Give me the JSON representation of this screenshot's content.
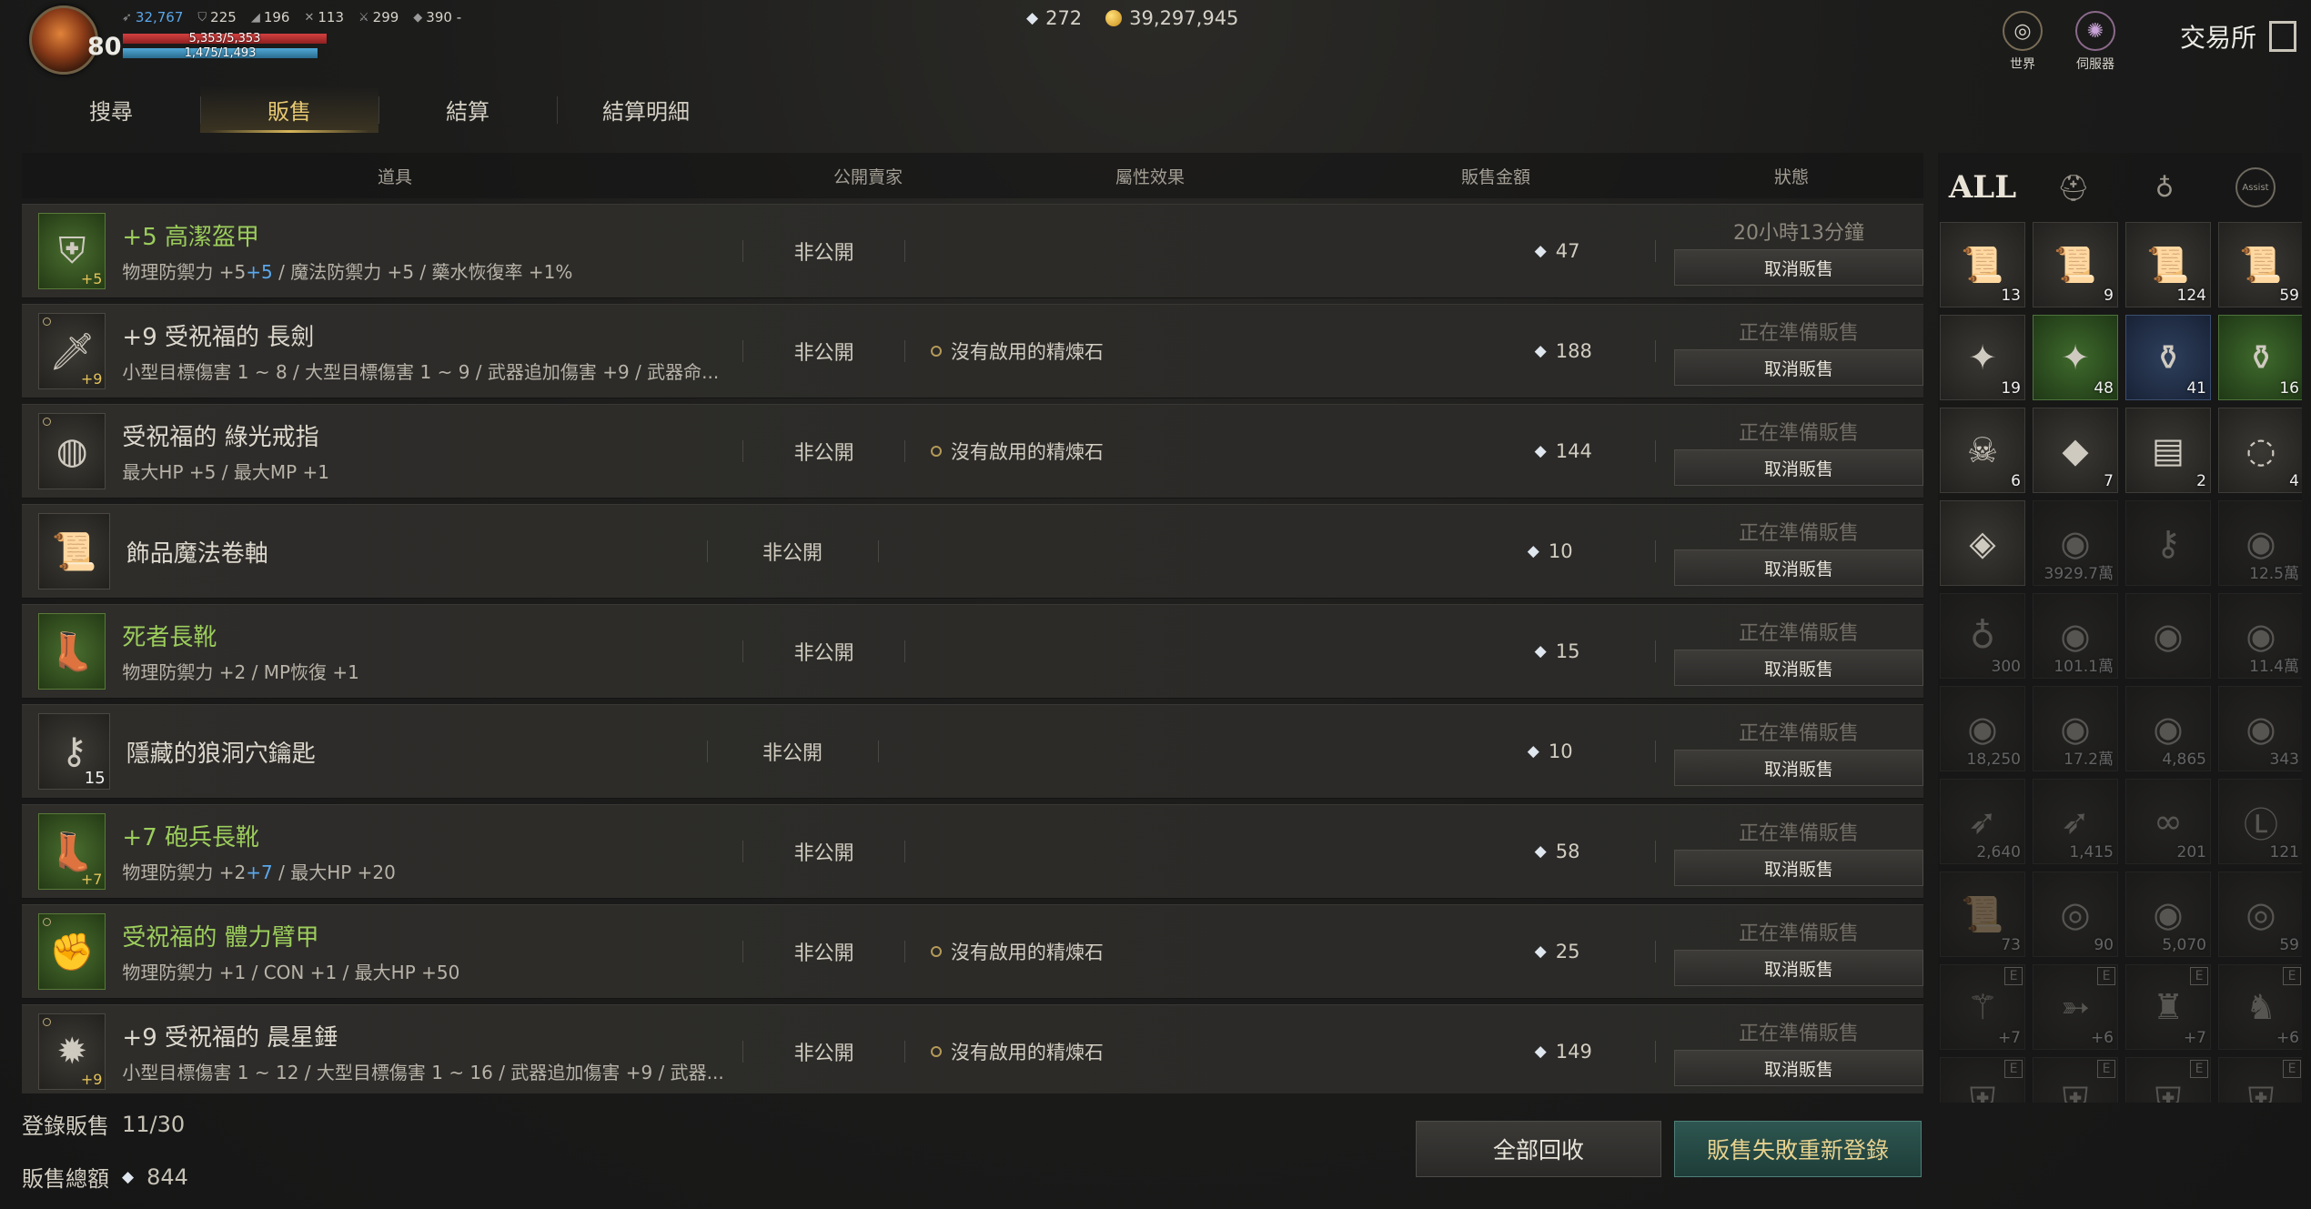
{
  "player": {
    "level": "80",
    "stats": [
      "32,767",
      "225",
      "196",
      "113",
      "299",
      "390 -"
    ],
    "hp": "5,353/5,353",
    "mp": "1,475/1,493"
  },
  "currency": {
    "gems": "272",
    "gold": "39,297,945"
  },
  "top_buttons": {
    "world": "世界",
    "server": "伺服器"
  },
  "exchange_title": "交易所",
  "tabs": [
    "搜尋",
    "販售",
    "結算",
    "結算明細"
  ],
  "table": {
    "headers": {
      "item": "道具",
      "buyer": "公開賣家",
      "effect": "屬性效果",
      "price": "販售金額",
      "status": "狀態"
    },
    "rows": [
      {
        "name": "+5 高潔盔甲",
        "name_color": "green",
        "attr_pre": "物理防禦力 +5",
        "attr_blue": "+5",
        "attr_post": " / 魔法防禦力 +5 / 藥水恢復率 +1%",
        "public": "非公開",
        "effect": "",
        "price": "47",
        "status": "20小時13分鐘",
        "cancel": "取消販售",
        "icon": "armor-icon",
        "plus": "+5",
        "qty": ""
      },
      {
        "name": "+9 受祝福的 長劍",
        "name_color": "white",
        "attr_pre": "小型目標傷害 1 ~ 8 / 大型目標傷害 1 ~ 9 / 武器追加傷害 +9 / 武器命...",
        "attr_blue": "",
        "attr_post": "",
        "public": "非公開",
        "effect": "沒有啟用的精煉石",
        "price": "188",
        "status": "正在準備販售",
        "cancel": "取消販售",
        "icon": "sword-icon",
        "plus": "+9",
        "qty": ""
      },
      {
        "name": "受祝福的 綠光戒指",
        "name_color": "white",
        "attr_pre": "最大HP +5 / 最大MP +1",
        "attr_blue": "",
        "attr_post": "",
        "public": "非公開",
        "effect": "沒有啟用的精煉石",
        "price": "144",
        "status": "正在準備販售",
        "cancel": "取消販售",
        "icon": "ring-icon",
        "plus": "",
        "qty": ""
      },
      {
        "name": "飾品魔法卷軸",
        "name_color": "white",
        "attr_pre": "",
        "attr_blue": "",
        "attr_post": "",
        "public": "非公開",
        "effect": "",
        "price": "10",
        "status": "正在準備販售",
        "cancel": "取消販售",
        "icon": "scroll-icon",
        "plus": "",
        "qty": ""
      },
      {
        "name": "死者長靴",
        "name_color": "green",
        "attr_pre": "物理防禦力 +2 / MP恢復 +1",
        "attr_blue": "",
        "attr_post": "",
        "public": "非公開",
        "effect": "",
        "price": "15",
        "status": "正在準備販售",
        "cancel": "取消販售",
        "icon": "boots-icon",
        "plus": "",
        "qty": ""
      },
      {
        "name": "隱藏的狼洞穴鑰匙",
        "name_color": "white",
        "attr_pre": "",
        "attr_blue": "",
        "attr_post": "",
        "public": "非公開",
        "effect": "",
        "price": "10",
        "status": "正在準備販售",
        "cancel": "取消販售",
        "icon": "key-icon",
        "plus": "",
        "qty": "15"
      },
      {
        "name": "+7 砲兵長靴",
        "name_color": "green",
        "attr_pre": "物理防禦力 +2",
        "attr_blue": "+7",
        "attr_post": " / 最大HP +20",
        "public": "非公開",
        "effect": "",
        "price": "58",
        "status": "正在準備販售",
        "cancel": "取消販售",
        "icon": "boots-icon",
        "plus": "+7",
        "qty": ""
      },
      {
        "name": "受祝福的 體力臂甲",
        "name_color": "green",
        "attr_pre": "物理防禦力 +1 / CON +1 / 最大HP +50",
        "attr_blue": "",
        "attr_post": "",
        "public": "非公開",
        "effect": "沒有啟用的精煉石",
        "price": "25",
        "status": "正在準備販售",
        "cancel": "取消販售",
        "icon": "gauntlet-icon",
        "plus": "",
        "qty": ""
      },
      {
        "name": "+9 受祝福的 晨星錘",
        "name_color": "white",
        "attr_pre": "小型目標傷害 1 ~ 12 / 大型目標傷害 1 ~ 16 / 武器追加傷害 +9 / 武器...",
        "attr_blue": "",
        "attr_post": "",
        "public": "非公開",
        "effect": "沒有啟用的精煉石",
        "price": "149",
        "status": "正在準備販售",
        "cancel": "取消販售",
        "icon": "mace-icon",
        "plus": "+9",
        "qty": ""
      }
    ]
  },
  "footer": {
    "listed_label": "登錄販售",
    "listed_value": "11/30",
    "total_label": "販售總額",
    "total_value": "844",
    "recall_button": "全部回收",
    "relist_button": "販售失敗重新登錄"
  },
  "inventory": {
    "categories": [
      "ALL",
      "helmet-icon",
      "bag-icon",
      "Assist"
    ],
    "slots": [
      {
        "icon": "scroll-icon",
        "count": "13",
        "style": "normal"
      },
      {
        "icon": "scroll-icon",
        "count": "9",
        "style": "normal"
      },
      {
        "icon": "scroll-icon",
        "count": "124",
        "style": "normal"
      },
      {
        "icon": "scroll-icon",
        "count": "59",
        "style": "normal"
      },
      {
        "icon": "crystal-icon",
        "count": "19",
        "style": "normal"
      },
      {
        "icon": "crystal-icon",
        "count": "48",
        "style": "green"
      },
      {
        "icon": "potion-icon",
        "count": "41",
        "style": "blue"
      },
      {
        "icon": "potion-icon",
        "count": "16",
        "style": "green"
      },
      {
        "icon": "bone-icon",
        "count": "6",
        "style": "normal"
      },
      {
        "icon": "gem-icon",
        "count": "7",
        "style": "normal"
      },
      {
        "icon": "log-icon",
        "count": "2",
        "style": "normal"
      },
      {
        "icon": "cloth-icon",
        "count": "4",
        "style": "normal"
      },
      {
        "icon": "diamond-icon",
        "count": "",
        "style": "normal"
      },
      {
        "icon": "coin-icon",
        "count": "3929.7萬",
        "style": "dim"
      },
      {
        "icon": "key-icon",
        "count": "",
        "style": "dim"
      },
      {
        "icon": "coin-icon",
        "count": "12.5萬",
        "style": "dim"
      },
      {
        "icon": "bag-icon",
        "count": "300",
        "style": "dim"
      },
      {
        "icon": "coin-icon",
        "count": "101.1萬",
        "style": "dim"
      },
      {
        "icon": "coin-icon",
        "count": "",
        "style": "dim"
      },
      {
        "icon": "coin-icon",
        "count": "11.4萬",
        "style": "dim"
      },
      {
        "icon": "coin-icon",
        "count": "18,250",
        "style": "dim"
      },
      {
        "icon": "coin-icon",
        "count": "17.2萬",
        "style": "dim"
      },
      {
        "icon": "coin-icon",
        "count": "4,865",
        "style": "dim"
      },
      {
        "icon": "coin-icon",
        "count": "343",
        "style": "dim"
      },
      {
        "icon": "feather-icon",
        "count": "2,640",
        "style": "dim"
      },
      {
        "icon": "feather-icon",
        "count": "1,415",
        "style": "dim"
      },
      {
        "icon": "infinity-icon",
        "count": "201",
        "style": "dim"
      },
      {
        "icon": "lv-icon",
        "count": "121",
        "style": "dim"
      },
      {
        "icon": "scroll-icon",
        "count": "73",
        "style": "dim"
      },
      {
        "icon": "orb-icon",
        "count": "90",
        "style": "dim"
      },
      {
        "icon": "eye-icon",
        "count": "5,070",
        "style": "dim"
      },
      {
        "icon": "orb-icon",
        "count": "59",
        "style": "dim"
      },
      {
        "icon": "wand-icon",
        "count": "+7",
        "style": "dim",
        "tag": "E"
      },
      {
        "icon": "bow-icon",
        "count": "+6",
        "style": "dim",
        "tag": "E"
      },
      {
        "icon": "robe-icon",
        "count": "+7",
        "style": "dim",
        "tag": "E"
      },
      {
        "icon": "cloak-icon",
        "count": "+6",
        "style": "dim",
        "tag": "E"
      },
      {
        "icon": "armor-icon",
        "count": "",
        "style": "dim",
        "tag": "E"
      },
      {
        "icon": "armor-icon",
        "count": "",
        "style": "dim",
        "tag": "E"
      },
      {
        "icon": "armor-icon",
        "count": "",
        "style": "dim",
        "tag": "E"
      },
      {
        "icon": "armor-icon",
        "count": "",
        "style": "dim",
        "tag": "E"
      }
    ]
  }
}
